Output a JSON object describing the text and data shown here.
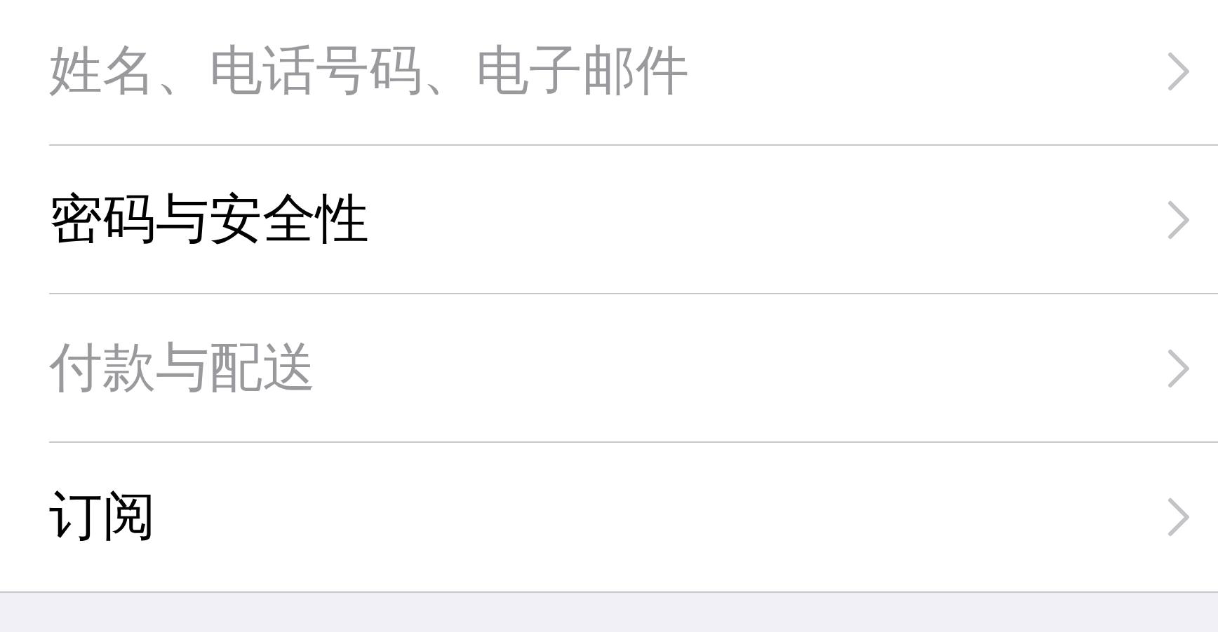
{
  "rows": [
    {
      "label": "姓名、电话号码、电子邮件",
      "disabled": true
    },
    {
      "label": "密码与安全性",
      "disabled": false
    },
    {
      "label": "付款与配送",
      "disabled": true
    },
    {
      "label": "订阅",
      "disabled": false
    }
  ]
}
